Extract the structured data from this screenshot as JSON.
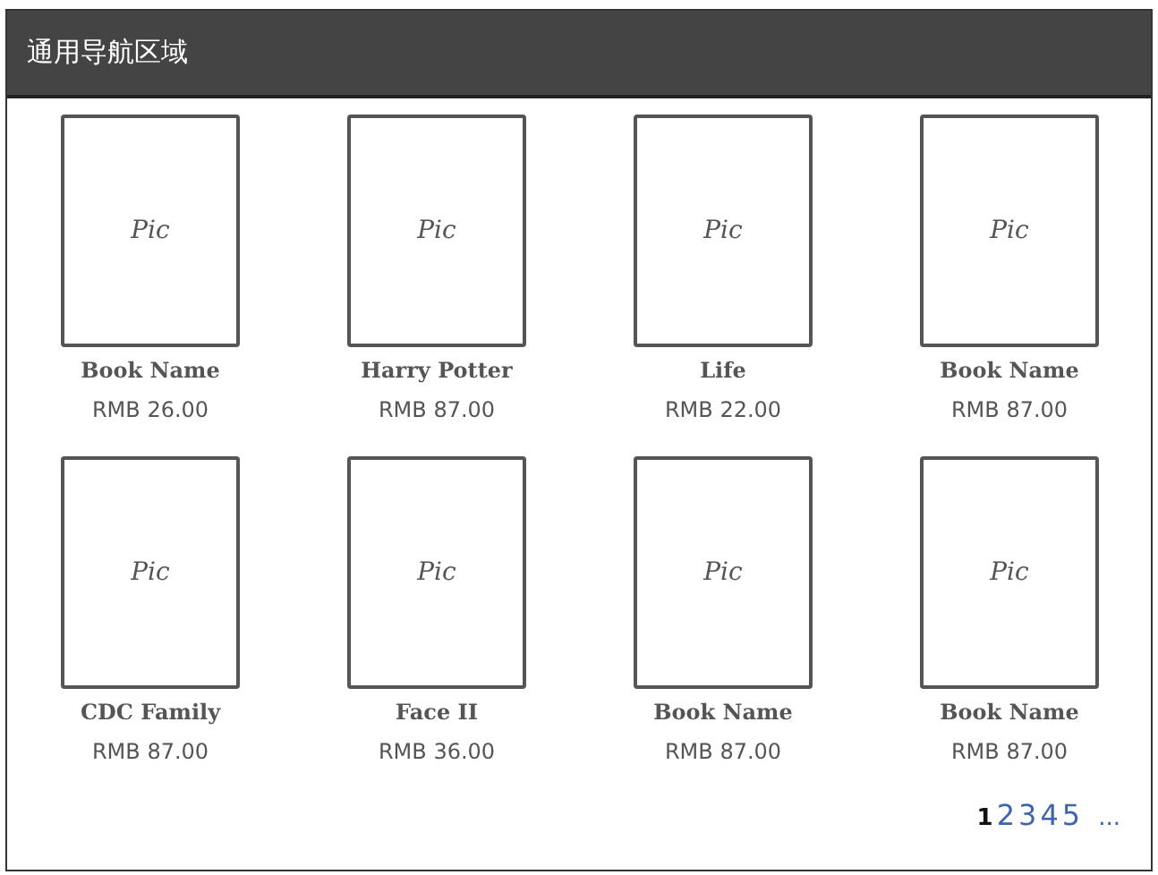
{
  "header": {
    "title": "通用导航区域"
  },
  "books": [
    {
      "pic": "Pic",
      "name": "Book Name",
      "price": "RMB 26.00"
    },
    {
      "pic": "Pic",
      "name": "Harry Potter",
      "price": "RMB 87.00"
    },
    {
      "pic": "Pic",
      "name": "Life",
      "price": "RMB 22.00"
    },
    {
      "pic": "Pic",
      "name": "Book Name",
      "price": "RMB 87.00"
    },
    {
      "pic": "Pic",
      "name": "CDC Family",
      "price": "RMB 87.00"
    },
    {
      "pic": "Pic",
      "name": "Face II",
      "price": "RMB 36.00"
    },
    {
      "pic": "Pic",
      "name": "Book Name",
      "price": "RMB 87.00"
    },
    {
      "pic": "Pic",
      "name": "Book Name",
      "price": "RMB 87.00"
    }
  ],
  "pagination": {
    "pages": [
      {
        "label": "1",
        "selected": true
      },
      {
        "label": "2",
        "selected": false
      },
      {
        "label": "3",
        "selected": false
      },
      {
        "label": "4",
        "selected": false
      },
      {
        "label": "5",
        "selected": false
      }
    ],
    "more": "..."
  }
}
